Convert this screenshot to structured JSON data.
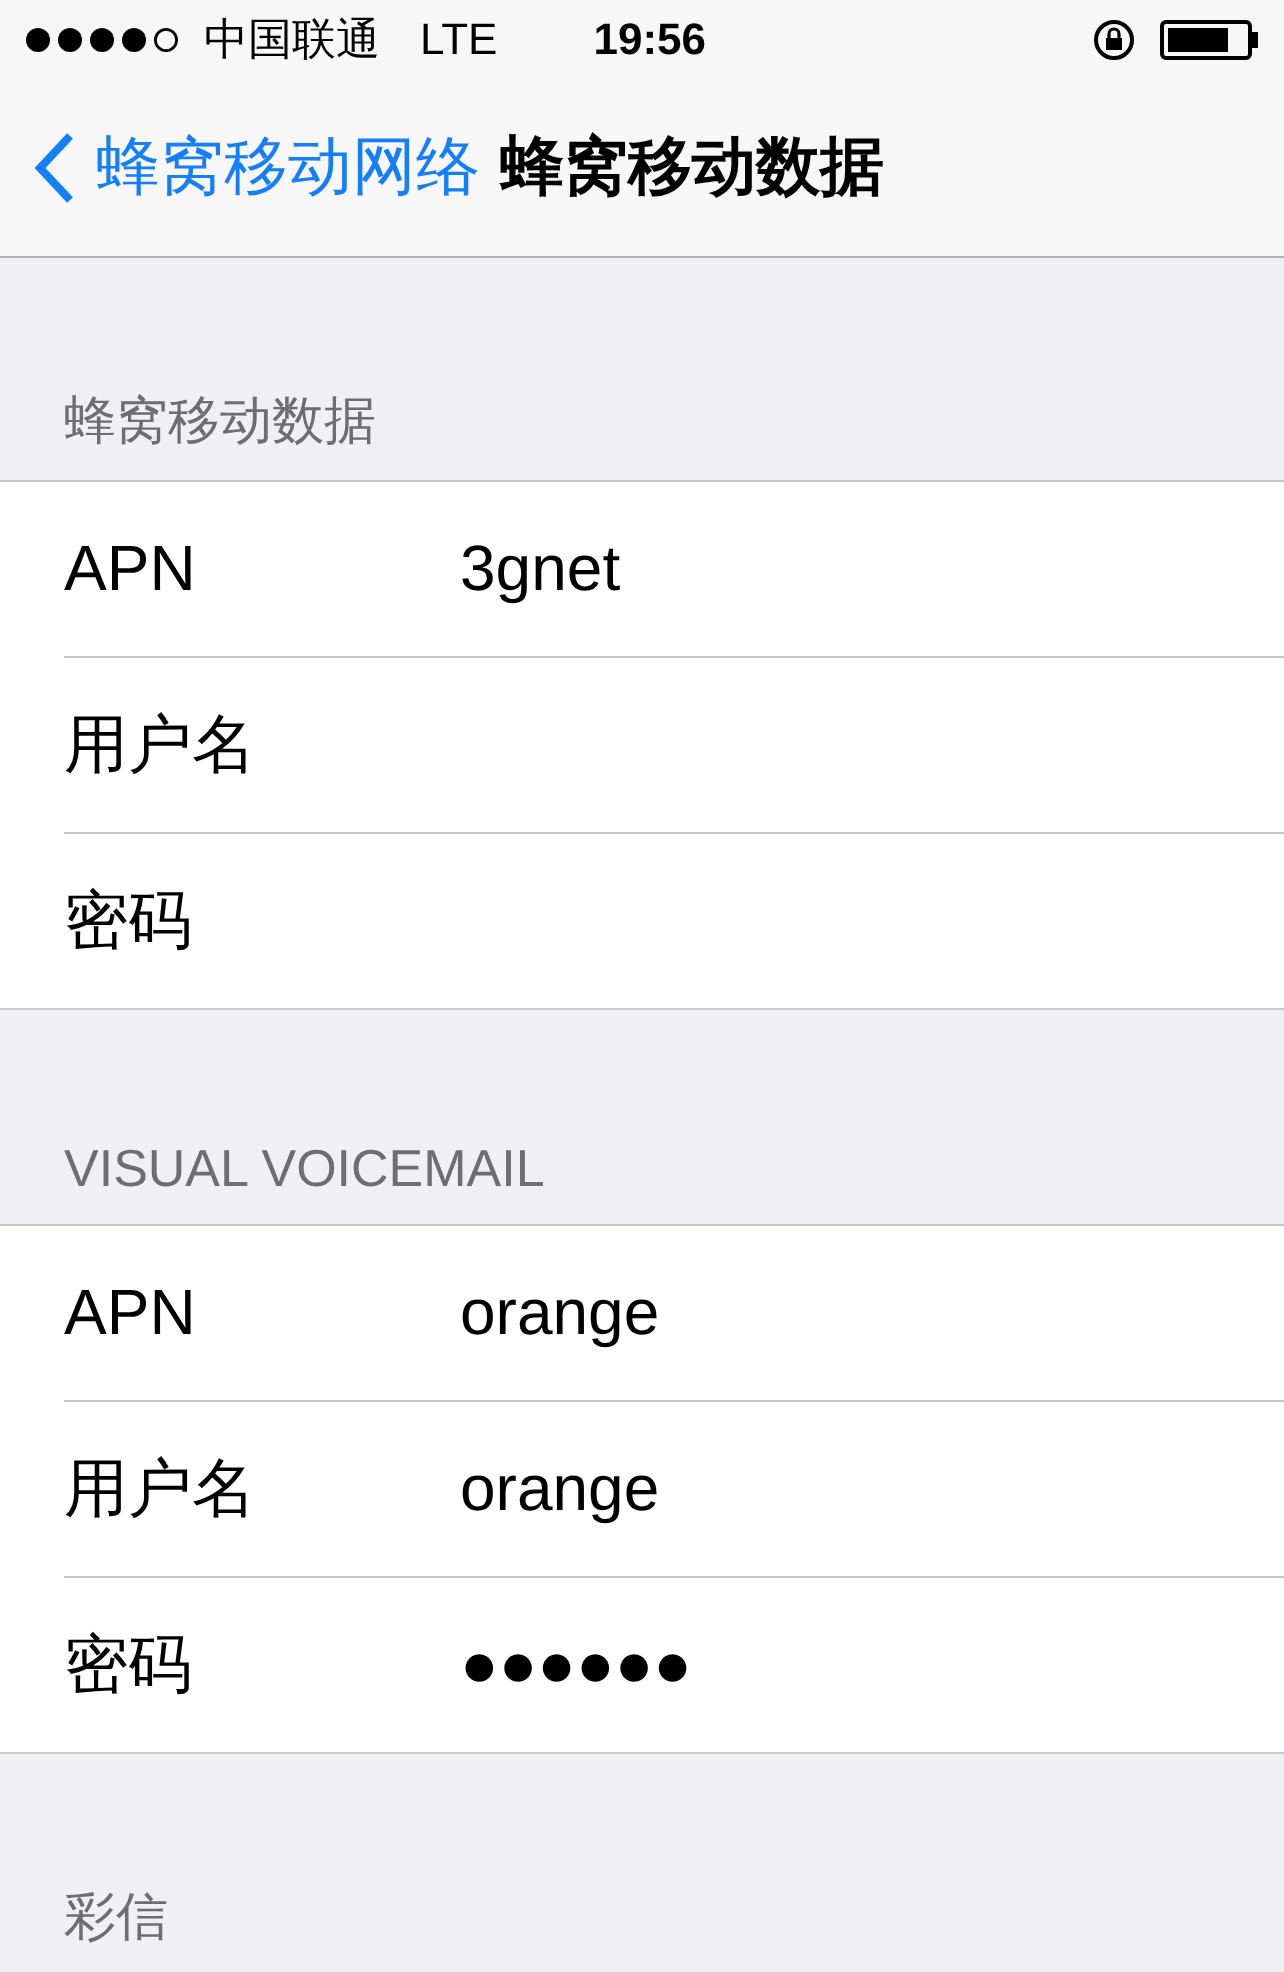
{
  "status_bar": {
    "carrier": "中国联通",
    "network": "LTE",
    "time": "19:56"
  },
  "nav": {
    "back": "蜂窝移动网络",
    "title": "蜂窝移动数据"
  },
  "sections": [
    {
      "header": "蜂窝移动数据",
      "rows": [
        {
          "label": "APN",
          "value": "3gnet"
        },
        {
          "label": "用户名"
        },
        {
          "label": "密码"
        }
      ]
    },
    {
      "header": "VISUAL VOICEMAIL",
      "rows": [
        {
          "label": "APN",
          "value": "orange"
        },
        {
          "label": "用户名",
          "value": "orange"
        },
        {
          "label": "密码",
          "value": "●●●●●●"
        }
      ]
    },
    {
      "header": "彩信"
    }
  ]
}
